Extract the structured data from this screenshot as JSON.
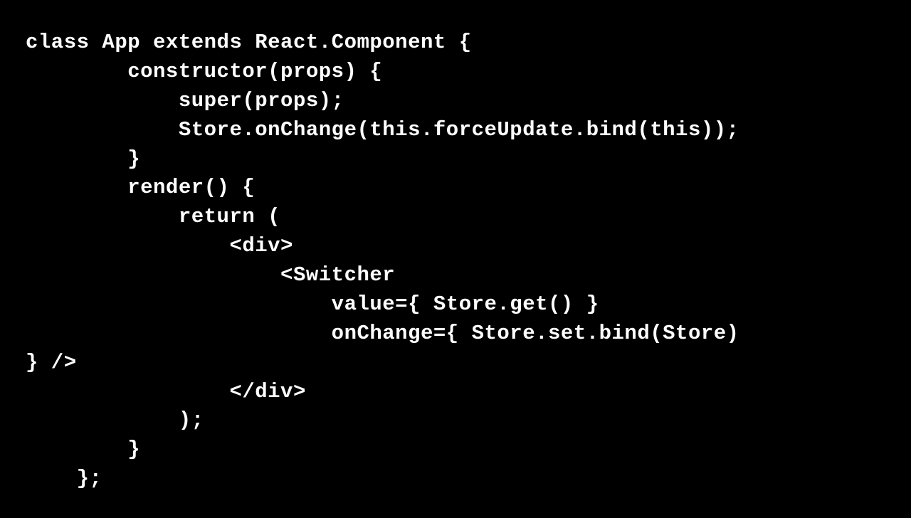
{
  "code": {
    "l1": "class App extends React.Component {",
    "l2": "        constructor(props) {",
    "l3": "            super(props);",
    "l4": "            Store.onChange(this.forceUpdate.bind(this));",
    "l5": "        }",
    "l6": "        render() {",
    "l7": "            return (",
    "l8": "                <div>",
    "l9": "                    <Switcher",
    "l10": "                        value={ Store.get() }",
    "l11": "                        onChange={ Store.set.bind(Store)",
    "l12": "} />",
    "l13": "                </div>",
    "l14": "            );",
    "l15": "        }",
    "l16": "    };"
  }
}
